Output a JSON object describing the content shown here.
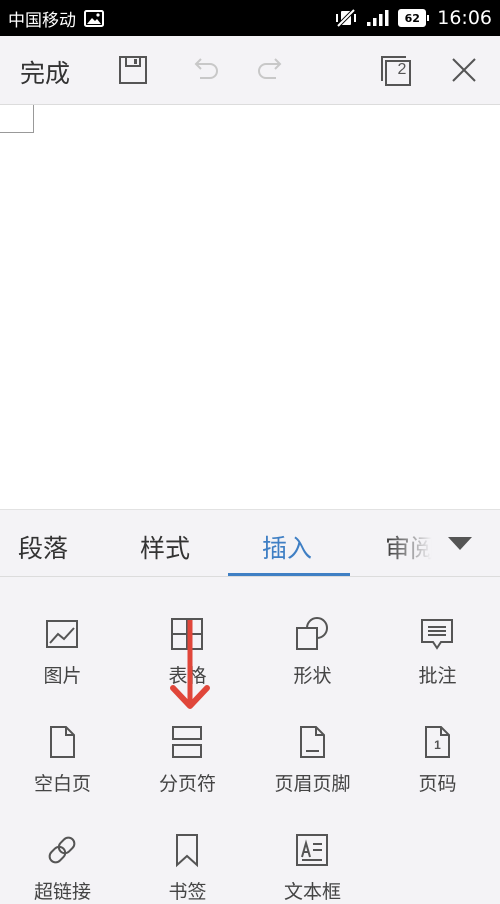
{
  "status_bar": {
    "carrier": "中国移动",
    "battery": "62",
    "time": "16:06"
  },
  "toolbar": {
    "done_label": "完成",
    "window_count": "2",
    "icons": [
      "save-icon",
      "undo-icon",
      "redo-icon",
      "window-switch-icon",
      "close-icon"
    ]
  },
  "tabs": [
    {
      "label": "段落"
    },
    {
      "label": "样式"
    },
    {
      "label": "插入",
      "active": true
    },
    {
      "label": "审阅"
    }
  ],
  "insert_items": [
    {
      "label": "图片",
      "icon": "image-icon"
    },
    {
      "label": "表格",
      "icon": "table-icon"
    },
    {
      "label": "形状",
      "icon": "shape-icon"
    },
    {
      "label": "批注",
      "icon": "comment-icon"
    },
    {
      "label": "空白页",
      "icon": "blank-page-icon"
    },
    {
      "label": "分页符",
      "icon": "page-break-icon"
    },
    {
      "label": "页眉页脚",
      "icon": "header-footer-icon"
    },
    {
      "label": "页码",
      "icon": "page-number-icon"
    },
    {
      "label": "超链接",
      "icon": "link-icon"
    },
    {
      "label": "书签",
      "icon": "bookmark-icon"
    },
    {
      "label": "文本框",
      "icon": "textbox-icon"
    }
  ],
  "page_number_glyph": "1",
  "colors": {
    "accent": "#3f7fc4",
    "annotation_arrow": "#e0463a",
    "icon": "#555555",
    "disabled_icon": "#c8c8c8"
  }
}
